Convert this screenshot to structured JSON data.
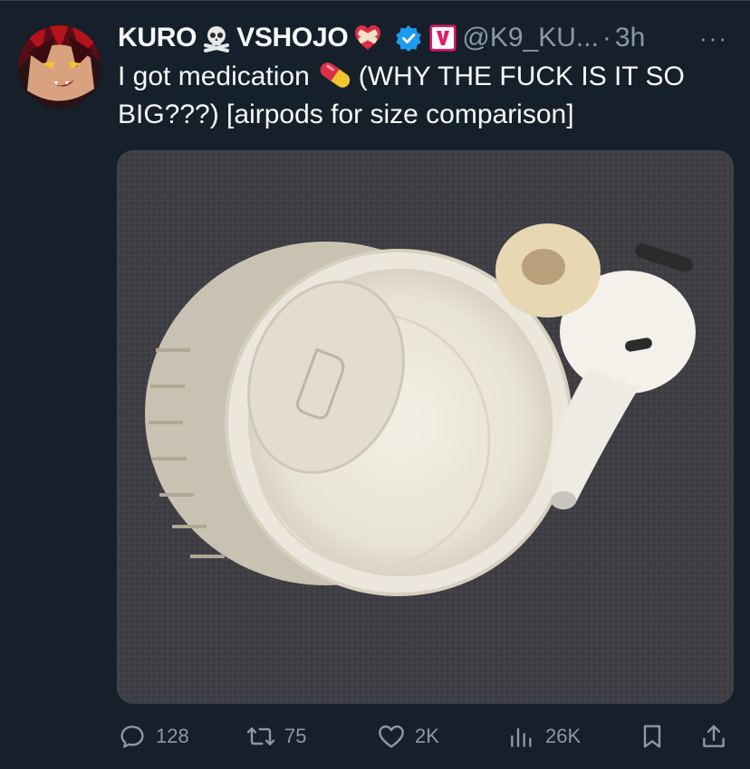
{
  "tweet": {
    "display_name_part1": "KURO",
    "display_name_part2": "VSHOJO",
    "handle": "@K9_KU...",
    "separator": "·",
    "time": "3h",
    "more_label": "···",
    "text_part1": "I got medication",
    "text_part2": "(WHY THE FUCK IS IT SO BIG???) [airpods for size comparison]"
  },
  "actions": {
    "replies": "128",
    "reposts": "75",
    "likes": "2K",
    "views": "26K"
  },
  "colors": {
    "background": "#15202b",
    "text": "#f7f9f9",
    "muted": "#8b98a5",
    "verified": "#1d9bf0",
    "vshojo_badge": "#e5186d"
  },
  "icons": {
    "skull": "skull-crossbones-icon",
    "heart": "mending-heart-icon",
    "verified": "verified-badge-icon",
    "affiliate": "vshojo-affiliate-badge-icon",
    "pill": "pill-icon",
    "reply": "reply-icon",
    "repost": "repost-icon",
    "like": "like-icon",
    "views": "views-icon",
    "bookmark": "bookmark-icon",
    "share": "share-icon"
  }
}
